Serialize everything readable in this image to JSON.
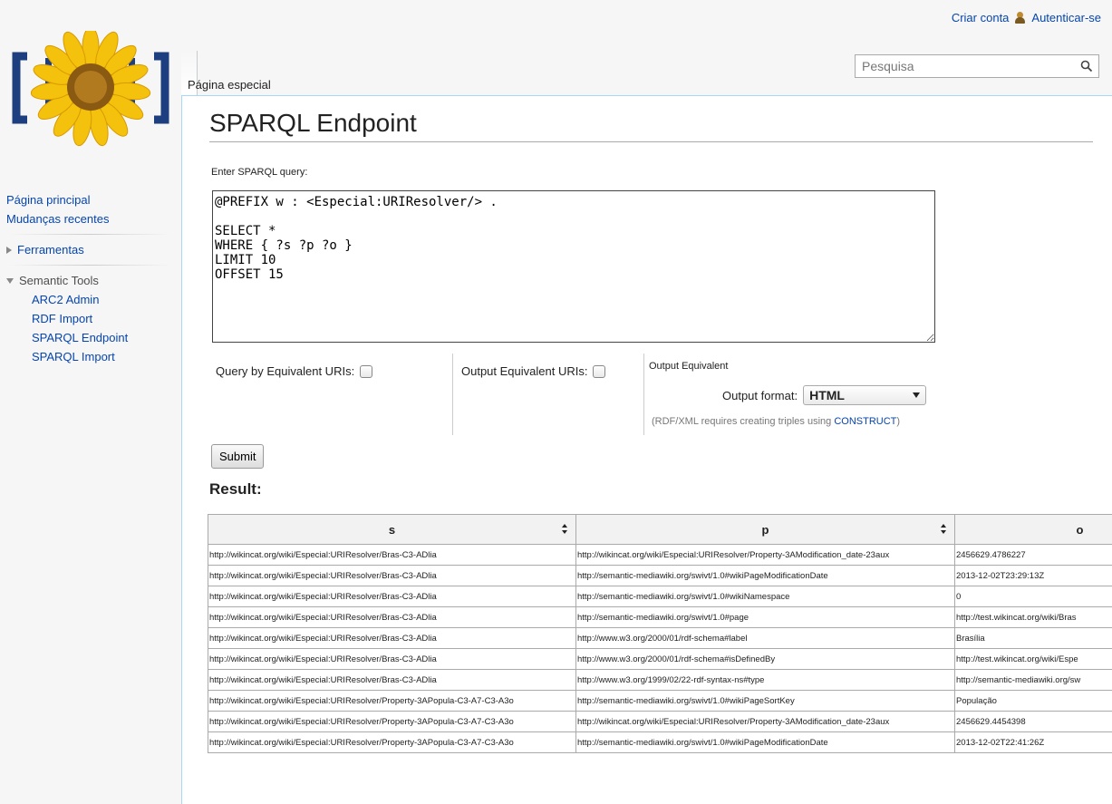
{
  "personal": {
    "create_account": "Criar conta",
    "login": "Autenticar-se"
  },
  "tabs": {
    "special_page": "Página especial"
  },
  "search": {
    "placeholder": "Pesquisa"
  },
  "sidebar": {
    "main_page": "Página principal",
    "recent_changes": "Mudanças recentes",
    "tools": "Ferramentas",
    "semantic_tools": "Semantic Tools",
    "semantic_items": [
      "ARC2 Admin",
      "RDF Import",
      "SPARQL Endpoint",
      "SPARQL Import"
    ]
  },
  "page": {
    "title": "SPARQL Endpoint",
    "query_label": "Enter SPARQL query:",
    "query": "@PREFIX w : <Especial:URIResolver/> .\n\nSELECT *\nWHERE { ?s ?p ?o }\nLIMIT 10\nOFFSET 15",
    "query_equiv_label": "Query by Equivalent URIs:",
    "output_equiv_label": "Output Equivalent URIs:",
    "output_equiv_heading": "Output Equivalent",
    "output_format_label": "Output format:",
    "output_format_value": "HTML",
    "note_prefix": "(RDF/XML requires creating triples using ",
    "note_link": "CONSTRUCT",
    "note_suffix": ")",
    "submit": "Submit",
    "result_heading": "Result:"
  },
  "result": {
    "columns": [
      "s",
      "p",
      "o"
    ],
    "rows": [
      [
        "http://wikincat.org/wiki/Especial:URIResolver/Bras-C3-ADlia",
        "http://wikincat.org/wiki/Especial:URIResolver/Property-3AModification_date-23aux",
        "2456629.4786227"
      ],
      [
        "http://wikincat.org/wiki/Especial:URIResolver/Bras-C3-ADlia",
        "http://semantic-mediawiki.org/swivt/1.0#wikiPageModificationDate",
        "2013-12-02T23:29:13Z"
      ],
      [
        "http://wikincat.org/wiki/Especial:URIResolver/Bras-C3-ADlia",
        "http://semantic-mediawiki.org/swivt/1.0#wikiNamespace",
        "0"
      ],
      [
        "http://wikincat.org/wiki/Especial:URIResolver/Bras-C3-ADlia",
        "http://semantic-mediawiki.org/swivt/1.0#page",
        "http://test.wikincat.org/wiki/Bras"
      ],
      [
        "http://wikincat.org/wiki/Especial:URIResolver/Bras-C3-ADlia",
        "http://www.w3.org/2000/01/rdf-schema#label",
        "Brasília"
      ],
      [
        "http://wikincat.org/wiki/Especial:URIResolver/Bras-C3-ADlia",
        "http://www.w3.org/2000/01/rdf-schema#isDefinedBy",
        "http://test.wikincat.org/wiki/Espe"
      ],
      [
        "http://wikincat.org/wiki/Especial:URIResolver/Bras-C3-ADlia",
        "http://www.w3.org/1999/02/22-rdf-syntax-ns#type",
        "http://semantic-mediawiki.org/sw"
      ],
      [
        "http://wikincat.org/wiki/Especial:URIResolver/Property-3APopula-C3-A7-C3-A3o",
        "http://semantic-mediawiki.org/swivt/1.0#wikiPageSortKey",
        "População"
      ],
      [
        "http://wikincat.org/wiki/Especial:URIResolver/Property-3APopula-C3-A7-C3-A3o",
        "http://wikincat.org/wiki/Especial:URIResolver/Property-3AModification_date-23aux",
        "2456629.4454398"
      ],
      [
        "http://wikincat.org/wiki/Especial:URIResolver/Property-3APopula-C3-A7-C3-A3o",
        "http://semantic-mediawiki.org/swivt/1.0#wikiPageModificationDate",
        "2013-12-02T22:41:26Z"
      ]
    ]
  }
}
